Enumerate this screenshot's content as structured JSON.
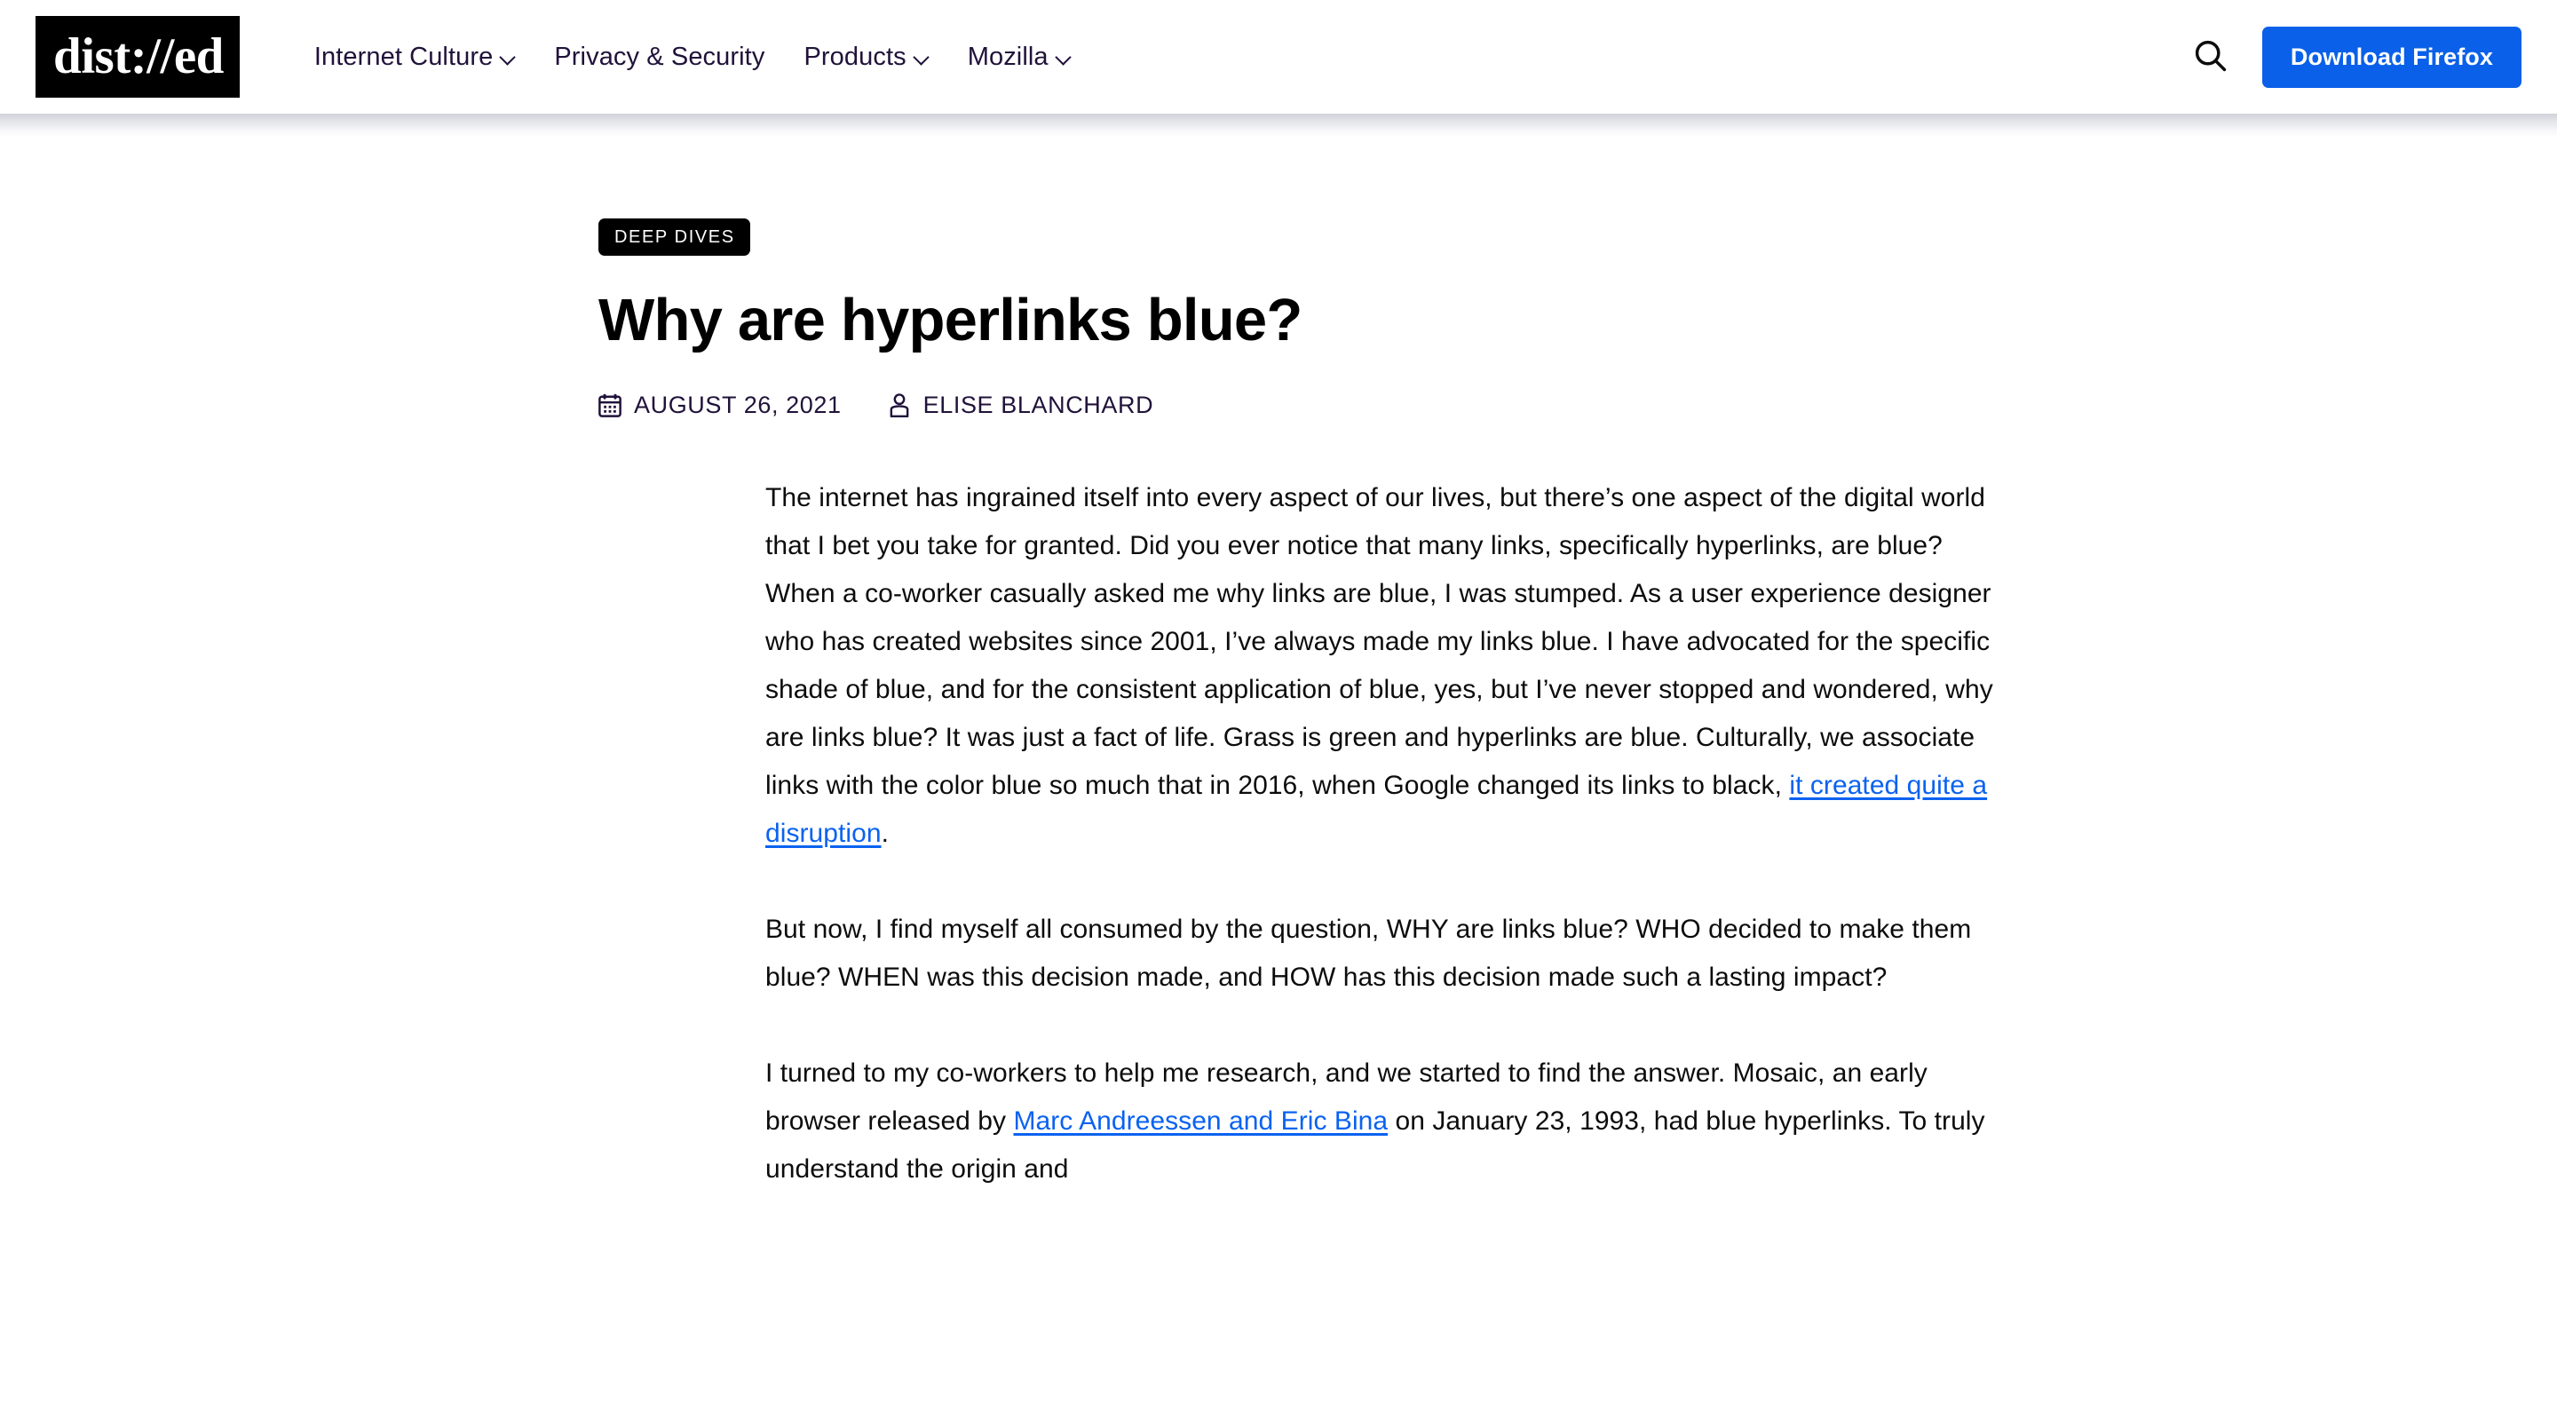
{
  "header": {
    "logo_text": "dist://ed",
    "nav_items": [
      {
        "label": "Internet Culture",
        "has_dropdown": true
      },
      {
        "label": "Privacy & Security",
        "has_dropdown": false
      },
      {
        "label": "Products",
        "has_dropdown": true
      },
      {
        "label": "Mozilla",
        "has_dropdown": true
      }
    ],
    "search_icon": "search-icon",
    "download_label": "Download Firefox",
    "accent_color": "#0a60e8",
    "nav_text_color": "#20123a"
  },
  "article": {
    "category": "DEEP DIVES",
    "title": "Why are hyperlinks blue?",
    "date": "AUGUST 26, 2021",
    "date_icon": "calendar-icon",
    "author": "ELISE BLANCHARD",
    "author_icon": "person-icon",
    "link_color": "#0a62f0",
    "paragraphs": [
      {
        "segments": [
          {
            "type": "text",
            "text": "The internet has ingrained itself into every aspect of our lives, but there’s one aspect of the digital world that I bet you take for granted. Did you ever notice that many links, specifically hyperlinks, are blue? When a co-worker casually asked me why links are blue, I was stumped. As a user experience designer who has created websites since 2001, I’ve always made my links blue. I have advocated for the specific shade of blue, and for the consistent application of blue, yes, but I’ve never stopped and wondered, why are links blue? It was just a fact of life. Grass is green and hyperlinks are blue. Culturally, we associate links with the color blue so much that in 2016, when Google changed its links to black, "
          },
          {
            "type": "link",
            "text": "it created quite a disruption"
          },
          {
            "type": "text",
            "text": "."
          }
        ]
      },
      {
        "segments": [
          {
            "type": "text",
            "text": "But now, I find myself all consumed by the question, WHY are links blue? WHO decided to make them blue? WHEN was this decision made, and HOW has this decision made such a lasting impact?"
          }
        ]
      },
      {
        "segments": [
          {
            "type": "text",
            "text": "I turned to my co-workers to help me research, and we started to find the answer. Mosaic, an early browser released by "
          },
          {
            "type": "link",
            "text": "Marc Andreessen and Eric Bina"
          },
          {
            "type": "text",
            "text": " on January 23, 1993, had blue hyperlinks. To truly understand the origin and"
          }
        ]
      }
    ]
  }
}
